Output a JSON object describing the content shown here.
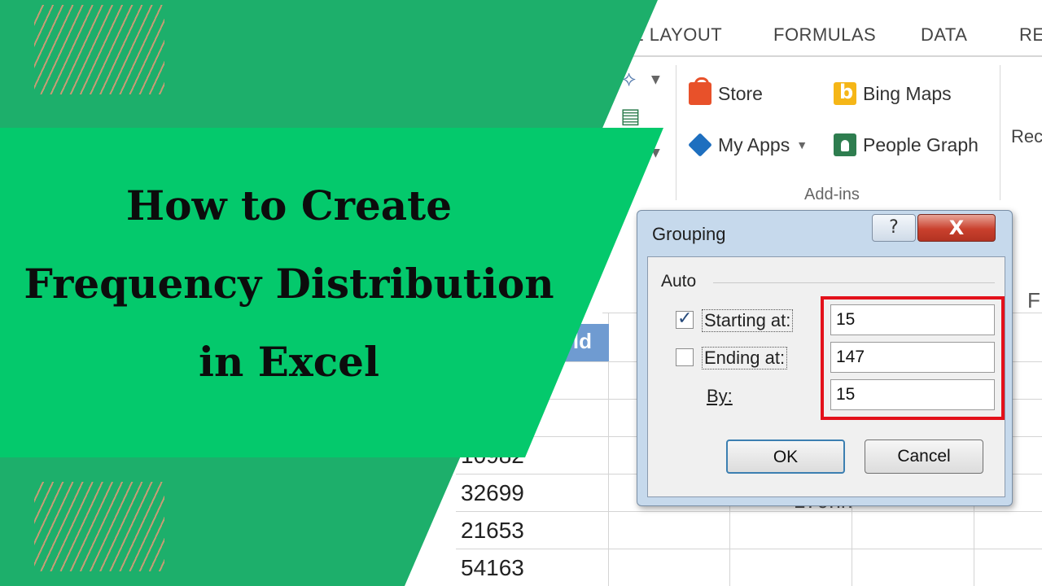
{
  "ribbon": {
    "tabs": [
      "E LAYOUT",
      "FORMULAS",
      "DATA",
      "RE"
    ],
    "addins": {
      "store": "Store",
      "bing_maps": "Bing Maps",
      "my_apps": "My Apps",
      "people_graph": "People Graph",
      "group_label": "Add-ins"
    },
    "next_group_partial": "Rec"
  },
  "sheet": {
    "header_partial": "old",
    "column_partial": "F",
    "values": [
      "10982",
      "32699",
      "21653",
      "54163"
    ],
    "behind_dialog_partial": "179nn"
  },
  "dialog": {
    "title": "Grouping",
    "help_glyph": "?",
    "close_glyph": "X",
    "group_label": "Auto",
    "starting_label": "Starting at:",
    "starting_checked": true,
    "starting_value": "15",
    "ending_label": "Ending at:",
    "ending_checked": false,
    "ending_value": "147",
    "by_label": "By:",
    "by_value": "15",
    "ok_label": "OK",
    "cancel_label": "Cancel",
    "highlight_color": "#e3111b"
  },
  "banner": {
    "line1": "How to Create",
    "line2": "Frequency Distribution",
    "line3": "in Excel",
    "colors": {
      "dark_green": "#1daf6b",
      "bright_green": "#04c96c"
    }
  }
}
